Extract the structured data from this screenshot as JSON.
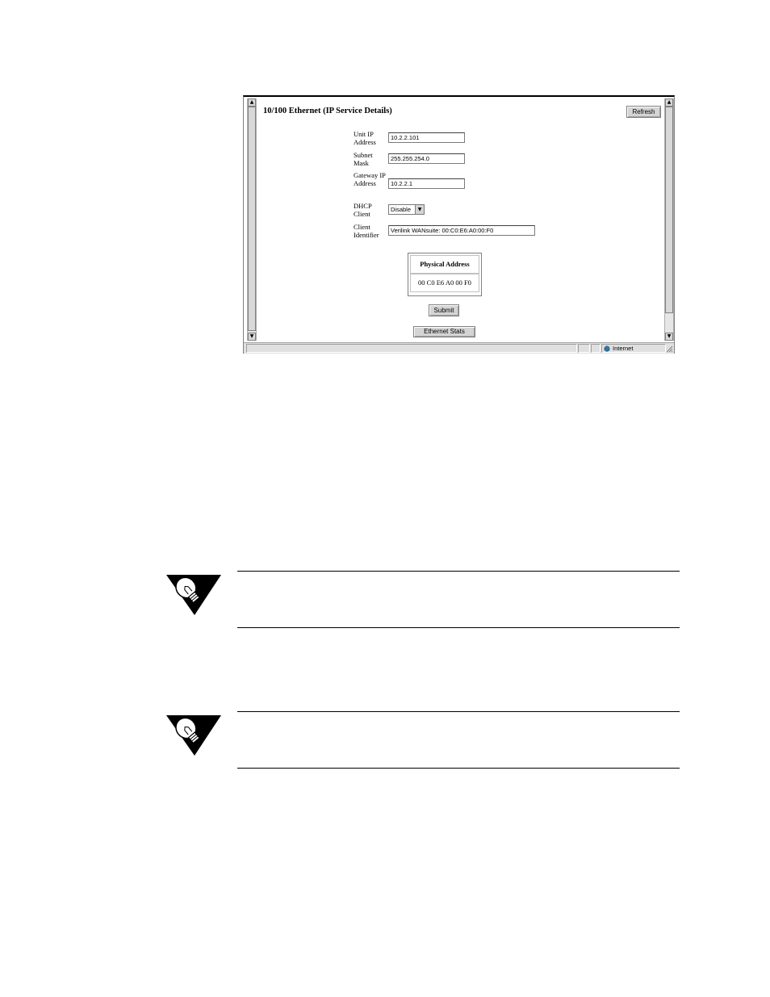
{
  "page": {
    "title": "10/100 Ethernet (IP Service Details)",
    "refresh_label": "Refresh"
  },
  "form": {
    "unit_ip": {
      "label": "Unit IP Address",
      "value": "10.2.2.101"
    },
    "subnet_mask": {
      "label": "Subnet Mask",
      "value": "255.255.254.0"
    },
    "gateway_ip": {
      "label": "Gateway IP Address",
      "value": "10.2.2.1"
    },
    "dhcp_client": {
      "label": "DHCP Client",
      "value": "Disable"
    },
    "client_identifier": {
      "label": "Client Identifier",
      "value": "Verilink WANsuite: 00:C0:E6:A0:00:F0"
    }
  },
  "physical_address": {
    "header": "Physical Address",
    "value": "00 C0 E6 A0 00 F0"
  },
  "buttons": {
    "submit_label": "Submit",
    "ethernet_stats_label": "Ethernet Stats"
  },
  "statusbar": {
    "zone_label": "Internet"
  },
  "icons": {
    "note_icon": "lightbulb-triangle-icon",
    "scroll_up": "arrow-up-icon",
    "scroll_down": "arrow-down-icon",
    "dropdown": "chevron-down-icon",
    "zone": "globe-icon"
  }
}
